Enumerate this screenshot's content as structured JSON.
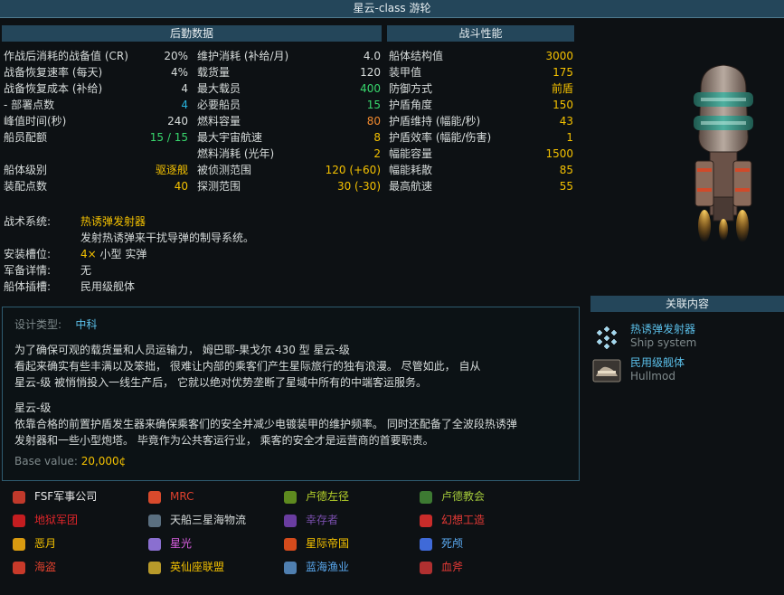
{
  "title": "星云-class 游轮",
  "logistics": {
    "header": "后勤数据",
    "left": [
      {
        "label": "作战后消耗的战备值 (CR)",
        "value": "20%",
        "color": "#d7dcdb"
      },
      {
        "label": "战备恢复速率 (每天)",
        "value": "4%",
        "color": "#d7dcdb"
      },
      {
        "label": "战备恢复成本 (补给)",
        "value": "4",
        "color": "#d7dcdb"
      },
      {
        "label": " - 部署点数",
        "value": "4",
        "color": "#28b4de"
      },
      {
        "label": "峰值时间(秒)",
        "value": "240",
        "color": "#d7dcdb"
      },
      {
        "label": "船员配额",
        "value": "15 / 15",
        "color": "#38d76d"
      },
      {
        "label": "",
        "value": "",
        "color": "#d7dcdb"
      },
      {
        "label": "船体级别",
        "value": "驱逐舰",
        "color": "#f4c100"
      },
      {
        "label": "装配点数",
        "value": "40",
        "color": "#f4c100"
      }
    ],
    "right": [
      {
        "label": "维护消耗 (补给/月)",
        "value": "4.0",
        "color": "#d7dcdb"
      },
      {
        "label": "载货量",
        "value": "120",
        "color": "#d7dcdb"
      },
      {
        "label": "最大载员",
        "value": "400",
        "color": "#38d76d"
      },
      {
        "label": "必要船员",
        "value": "15",
        "color": "#38d76d"
      },
      {
        "label": "燃料容量",
        "value": "80",
        "color": "#f28a2e"
      },
      {
        "label": "最大宇宙航速",
        "value": "8",
        "color": "#f4c100"
      },
      {
        "label": "燃料消耗 (光年)",
        "value": "2",
        "color": "#f4c100"
      },
      {
        "label": "被侦测范围",
        "value": "120 (+60)",
        "color": "#f4c100"
      },
      {
        "label": "探测范围",
        "value": "30 (-30)",
        "color": "#f4c100"
      }
    ]
  },
  "combat": {
    "header": "战斗性能",
    "rows": [
      {
        "label": "船体结构值",
        "value": "3000",
        "color": "#f4c100"
      },
      {
        "label": "装甲值",
        "value": "175",
        "color": "#f4c100"
      },
      {
        "label": "防御方式",
        "value": "前盾",
        "color": "#f4c100"
      },
      {
        "label": "护盾角度",
        "value": "150",
        "color": "#f4c100"
      },
      {
        "label": "护盾维持 (幅能/秒)",
        "value": "43",
        "color": "#f4c100"
      },
      {
        "label": "护盾效率 (幅能/伤害)",
        "value": "1",
        "color": "#f4c100"
      },
      {
        "label": "幅能容量",
        "value": "1500",
        "color": "#f4c100"
      },
      {
        "label": "幅能耗散",
        "value": "85",
        "color": "#f4c100"
      },
      {
        "label": "最高航速",
        "value": "55",
        "color": "#f4c100"
      }
    ]
  },
  "systems": {
    "tactical_label": "战术系统:",
    "tactical_name": "热诱弹发射器",
    "tactical_desc": "发射热诱弹来干扰导弹的制导系统。",
    "mounts_label": "安装槽位:",
    "mounts_count": "4×",
    "mounts_value": "小型 实弹",
    "armaments_label": "军备详情:",
    "armaments_value": "无",
    "hullmods_label": "船体插槽:",
    "hullmods_value": "民用级舰体"
  },
  "description": {
    "design_label": "设计类型:",
    "design_value": "中科",
    "para1": [
      "为了确保可观的载货量和人员运输力， 姆巴耶-果戈尔 430 型 星云-级",
      "看起来确实有些丰满以及笨拙， 很难让内部的乘客们产生星际旅行的独有浪漫。 尽管如此， 自从",
      "星云-级 被悄悄投入一线生产后， 它就以绝对优势垄断了星域中所有的中端客运服务。"
    ],
    "subtitle": "星云-级",
    "para2": [
      "依靠合格的前置护盾发生器来确保乘客们的安全并减少电镀装甲的维护频率。 同时还配备了全波段热诱弹",
      "发射器和一些小型炮塔。 毕竟作为公共客运行业， 乘客的安全才是运营商的首要职责。"
    ],
    "base_value_label": "Base value:",
    "base_value": "20,000¢"
  },
  "related": {
    "header": "关联内容",
    "items": [
      {
        "title": "热诱弹发射器",
        "subtitle": "Ship system",
        "icon": "flare-launcher-icon"
      },
      {
        "title": "民用级舰体",
        "subtitle": "Hullmod",
        "icon": "hullmod-icon"
      }
    ]
  },
  "factions": [
    {
      "name": "FSF军事公司",
      "color": "#e8e8e8",
      "icon_color": "#c0392b"
    },
    {
      "name": "MRC",
      "color": "#e0412e",
      "icon_color": "#d84a2c"
    },
    {
      "name": "卢德左径",
      "color": "#b6d22a",
      "icon_color": "#5e8a1f"
    },
    {
      "name": "卢德教会",
      "color": "#a2c83a",
      "icon_color": "#3d7a32"
    },
    {
      "name": "地狱军团",
      "color": "#e0252a",
      "icon_color": "#c41d20"
    },
    {
      "name": "天船三星海物流",
      "color": "#d7dcdb",
      "icon_color": "#5a6f80"
    },
    {
      "name": "幸存者",
      "color": "#7a4fae",
      "icon_color": "#6a3da0"
    },
    {
      "name": "幻想工造",
      "color": "#e93a36",
      "icon_color": "#c92c2a"
    },
    {
      "name": "恶月",
      "color": "#f4c100",
      "icon_color": "#d89a10"
    },
    {
      "name": "星光",
      "color": "#d95fe0",
      "icon_color": "#8a6fd0"
    },
    {
      "name": "星际帝国",
      "color": "#f4c100",
      "icon_color": "#d44b1c"
    },
    {
      "name": "死颅",
      "color": "#5aa9f0",
      "icon_color": "#3f6ad8"
    },
    {
      "name": "海盗",
      "color": "#e0412e",
      "icon_color": "#c83a2a"
    },
    {
      "name": "英仙座联盟",
      "color": "#f4c100",
      "icon_color": "#b89a2a"
    },
    {
      "name": "蓝海渔业",
      "color": "#5aa9f0",
      "icon_color": "#4f7fb0"
    },
    {
      "name": "血斧",
      "color": "#e93a36",
      "icon_color": "#b03030"
    }
  ]
}
